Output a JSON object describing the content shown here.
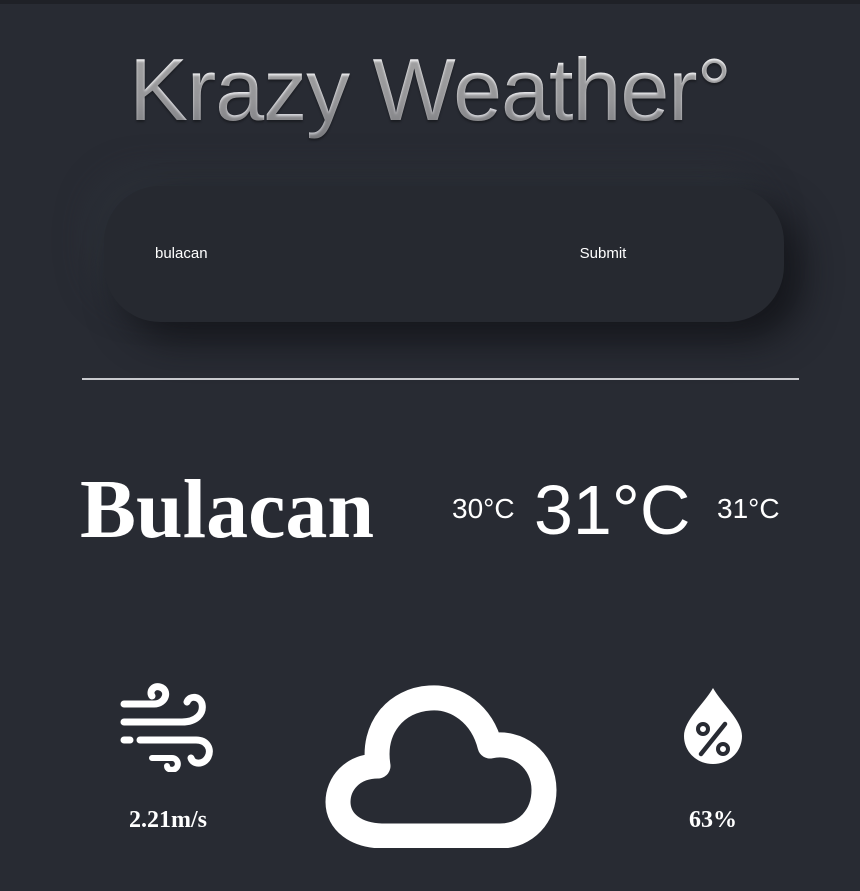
{
  "app": {
    "title": "Krazy Weather°"
  },
  "search": {
    "value": "bulacan",
    "submit_label": "Submit"
  },
  "weather": {
    "city": "Bulacan",
    "temp_min": "30°C",
    "temp_current": "31°C",
    "temp_max": "31°C",
    "wind_speed": "2.21m/s",
    "humidity": "63%",
    "condition_icon": "cloud-icon",
    "wind_icon": "wind-icon",
    "humidity_icon": "humidity-drop-icon"
  },
  "colors": {
    "background": "#282b33",
    "text": "#ffffff",
    "divider": "#c9cace"
  }
}
